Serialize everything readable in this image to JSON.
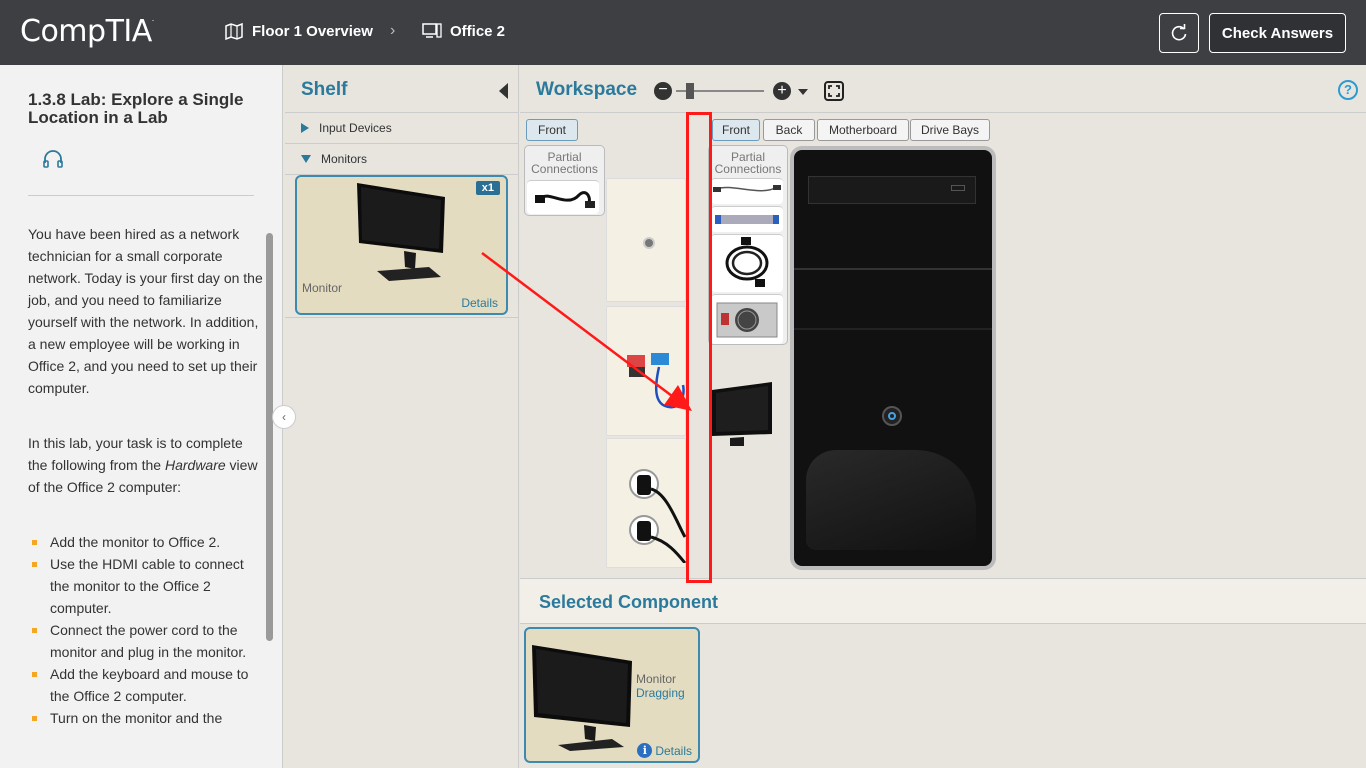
{
  "brand": {
    "logo": "CompTIA"
  },
  "header": {
    "breadcrumb_1": "Floor 1 Overview",
    "breadcrumb_2": "Office 2",
    "check_answers": "Check Answers"
  },
  "lab": {
    "title": "1.3.8 Lab: Explore a Single Location in a Lab",
    "para1": "You have been hired as a network technician for a small corporate network. Today is your first day on the job, and you need to familiarize yourself with the network. In addition, a new employee will be working in Office 2, and you need to set up their computer.",
    "para2_a": "In this lab, your task is to complete the following from the ",
    "para2_em": "Hardware",
    "para2_b": " view of the Office 2 computer:",
    "tasks": [
      "Add the monitor to Office 2.",
      "Use the HDMI cable to connect the monitor to the Office 2 computer.",
      "Connect the power cord to the monitor and plug in the monitor.",
      "Add the keyboard and mouse to the Office 2 computer.",
      "Turn on the monitor and the"
    ]
  },
  "shelf": {
    "title": "Shelf",
    "categories": [
      "Input Devices",
      "Monitors"
    ],
    "item": {
      "label": "Monitor",
      "badge": "x1",
      "details": "Details"
    }
  },
  "workspace": {
    "title": "Workspace",
    "help": "?",
    "left_tab": "Front",
    "partial_label": "Partial Connections",
    "pc_tabs": [
      "Front",
      "Back",
      "Motherboard",
      "Drive Bays"
    ]
  },
  "selected": {
    "title": "Selected Component",
    "name": "Monitor",
    "status": "Dragging",
    "details": "Details"
  },
  "colors": {
    "topbar": "#3d3f43",
    "accent": "#2b7a9b",
    "card": "#e3dcc1",
    "highlight": "#ff1a1a",
    "bullet": "#f5a623"
  }
}
